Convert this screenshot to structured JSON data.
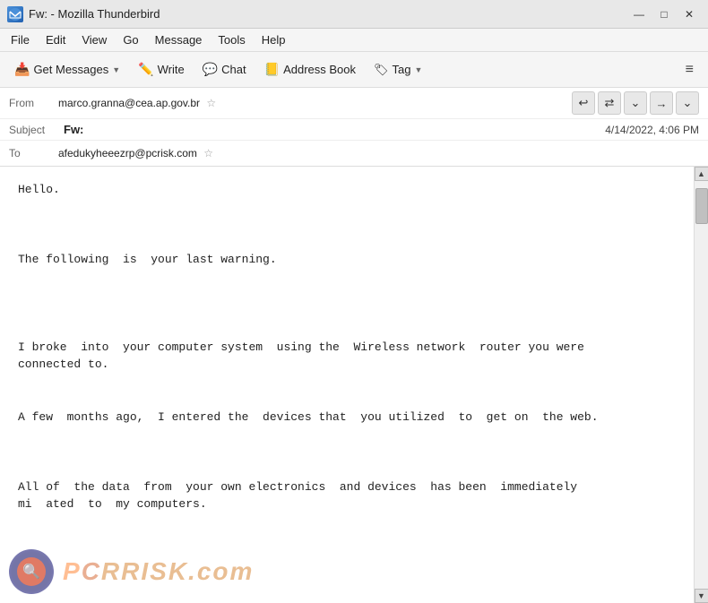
{
  "window": {
    "title": "Fw: - Mozilla Thunderbird"
  },
  "title_bar": {
    "icon": "TB",
    "title": "Fw: - Mozilla Thunderbird",
    "minimize": "—",
    "maximize": "□",
    "close": "✕"
  },
  "menu_bar": {
    "items": [
      "File",
      "Edit",
      "View",
      "Go",
      "Message",
      "Tools",
      "Help"
    ]
  },
  "toolbar": {
    "get_messages": "Get Messages",
    "write": "Write",
    "chat": "Chat",
    "address_book": "Address Book",
    "tag": "Tag",
    "hamburger": "≡"
  },
  "email": {
    "from_label": "From",
    "from_value": "marco.granna@cea.ap.gov.br",
    "subject_label": "Subject",
    "subject_value": "Fw:",
    "to_label": "To",
    "to_value": "afedukyheeezrp@pcrisk.com",
    "date": "4/14/2022, 4:06 PM",
    "nav_buttons": [
      "↩",
      "⇄",
      "⌄",
      "→",
      "⌄"
    ]
  },
  "body": {
    "text": "Hello.\n\n\n\nThe following  is  your last warning.\n\n\n\n\nI broke  into  your computer system  using the  Wireless network  router you were\nconnected to.\n\n\nA few  months ago,  I entered the  devices that  you utilized  to  get on  the web.\n\n\n\nAll of  the data  from  your own electronics  and devices  has been  immediately\nmi  ated  to  my computers."
  },
  "watermark": {
    "text": "RISK.com"
  }
}
